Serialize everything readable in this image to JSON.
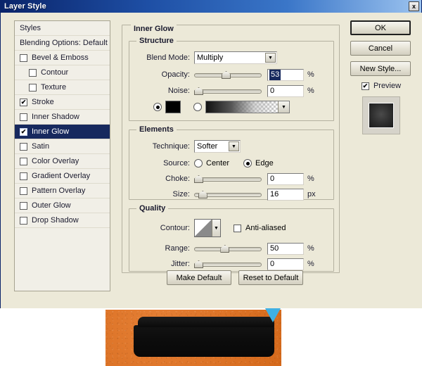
{
  "window": {
    "title": "Layer Style",
    "close_label": "x"
  },
  "styles_panel": {
    "items": [
      {
        "label": "Styles",
        "type": "header",
        "checked": false,
        "selected": false,
        "indented": false
      },
      {
        "label": "Blending Options: Default",
        "type": "header",
        "checked": false,
        "selected": false,
        "indented": false
      },
      {
        "label": "Bevel & Emboss",
        "type": "check",
        "checked": false,
        "selected": false,
        "indented": false
      },
      {
        "label": "Contour",
        "type": "check",
        "checked": false,
        "selected": false,
        "indented": true
      },
      {
        "label": "Texture",
        "type": "check",
        "checked": false,
        "selected": false,
        "indented": true
      },
      {
        "label": "Stroke",
        "type": "check",
        "checked": true,
        "selected": false,
        "indented": false
      },
      {
        "label": "Inner Shadow",
        "type": "check",
        "checked": false,
        "selected": false,
        "indented": false
      },
      {
        "label": "Inner Glow",
        "type": "check",
        "checked": true,
        "selected": true,
        "indented": false
      },
      {
        "label": "Satin",
        "type": "check",
        "checked": false,
        "selected": false,
        "indented": false
      },
      {
        "label": "Color Overlay",
        "type": "check",
        "checked": false,
        "selected": false,
        "indented": false
      },
      {
        "label": "Gradient Overlay",
        "type": "check",
        "checked": false,
        "selected": false,
        "indented": false
      },
      {
        "label": "Pattern Overlay",
        "type": "check",
        "checked": false,
        "selected": false,
        "indented": false
      },
      {
        "label": "Outer Glow",
        "type": "check",
        "checked": false,
        "selected": false,
        "indented": false
      },
      {
        "label": "Drop Shadow",
        "type": "check",
        "checked": false,
        "selected": false,
        "indented": false
      }
    ],
    "checkmark": "✔"
  },
  "effect": {
    "title": "Inner Glow"
  },
  "structure": {
    "title": "Structure",
    "blend_mode_label": "Blend Mode:",
    "blend_mode_value": "Multiply",
    "opacity_label": "Opacity:",
    "opacity_value": "53",
    "opacity_unit": "%",
    "opacity_slider_pct": 47,
    "noise_label": "Noise:",
    "noise_value": "0",
    "noise_unit": "%",
    "noise_slider_pct": 0,
    "fill_color_selected": true,
    "fill_color_hex": "#000000",
    "fill_gradient_selected": false
  },
  "elements": {
    "title": "Elements",
    "technique_label": "Technique:",
    "technique_value": "Softer",
    "source_label": "Source:",
    "source_center_label": "Center",
    "source_edge_label": "Edge",
    "source_selected": "Edge",
    "choke_label": "Choke:",
    "choke_value": "0",
    "choke_unit": "%",
    "choke_slider_pct": 0,
    "size_label": "Size:",
    "size_value": "16",
    "size_unit": "px",
    "size_slider_pct": 7
  },
  "quality": {
    "title": "Quality",
    "contour_label": "Contour:",
    "anti_aliased_label": "Anti-aliased",
    "anti_aliased_checked": false,
    "range_label": "Range:",
    "range_value": "50",
    "range_unit": "%",
    "range_slider_pct": 45,
    "jitter_label": "Jitter:",
    "jitter_value": "0",
    "jitter_unit": "%",
    "jitter_slider_pct": 0
  },
  "right_buttons": {
    "ok_label": "OK",
    "cancel_label": "Cancel",
    "new_style_label": "New Style...",
    "preview_label": "Preview",
    "preview_checked": true
  },
  "bottom_buttons": {
    "make_default_label": "Make Default",
    "reset_to_default_label": "Reset to Default"
  },
  "artwork": {
    "canvas_color": "#e2701d",
    "shape_color": "#0c0c0c",
    "arrow_color": "#3fb4e8"
  },
  "icons": {
    "dropdown_arrow": "▼"
  }
}
